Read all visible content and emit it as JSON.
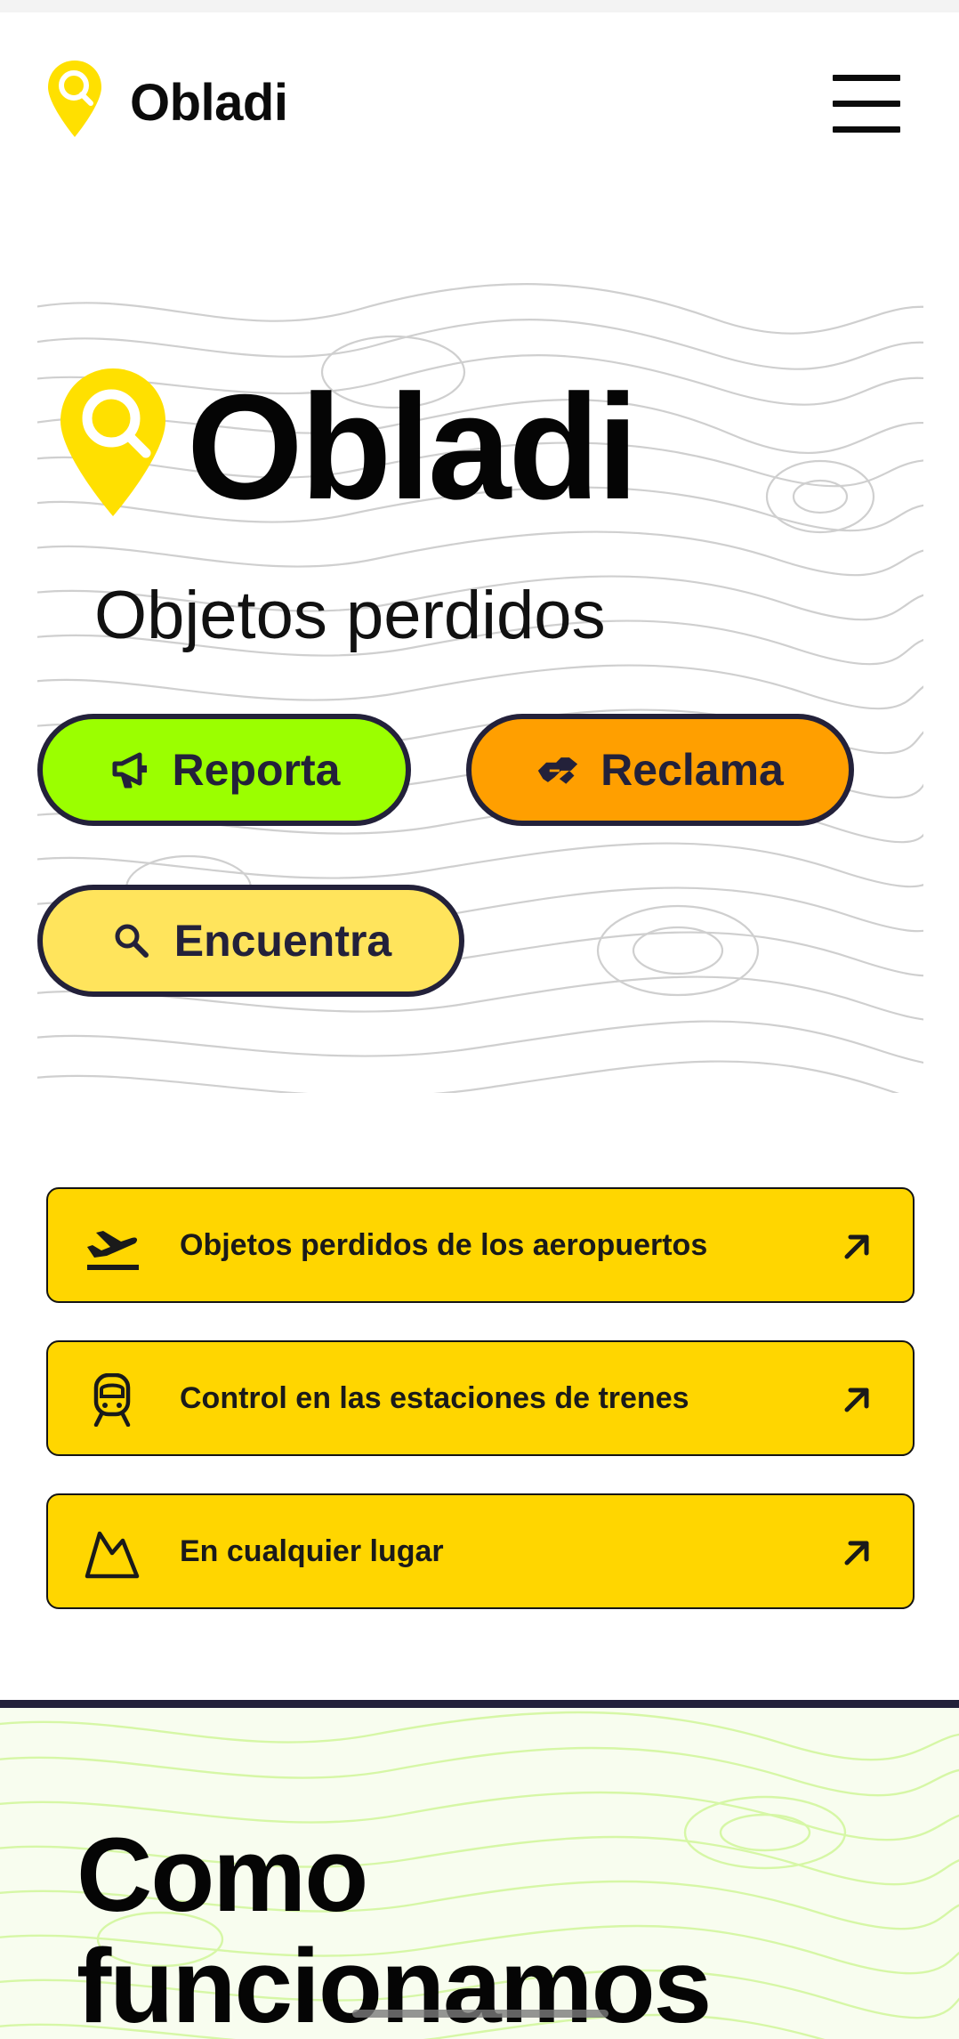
{
  "header": {
    "brand_name": "Obladi",
    "brand_icon": "location-pin-search-icon",
    "menu_icon": "hamburger-menu-icon"
  },
  "hero": {
    "title": "Obladi",
    "subtitle": "Objetos perdidos",
    "actions": [
      {
        "label": "Reporta",
        "icon": "megaphone-icon",
        "color": "#9bff00"
      },
      {
        "label": "Reclama",
        "icon": "handshake-icon",
        "color": "#ff9f00"
      },
      {
        "label": "Encuentra",
        "icon": "search-icon",
        "color": "#ffe45c"
      }
    ]
  },
  "quick_links": [
    {
      "label": "Objetos perdidos de los aeropuertos",
      "icon": "plane-departure-icon"
    },
    {
      "label": "Control en las estaciones de trenes",
      "icon": "train-icon"
    },
    {
      "label": "En cualquier lugar",
      "icon": "mountain-icon"
    }
  ],
  "how_section": {
    "title_line1": "Como",
    "title_line2": "funcionamos"
  },
  "colors": {
    "brand_yellow": "#ffd600",
    "pin_yellow": "#ffe000",
    "dark": "#23213a"
  }
}
